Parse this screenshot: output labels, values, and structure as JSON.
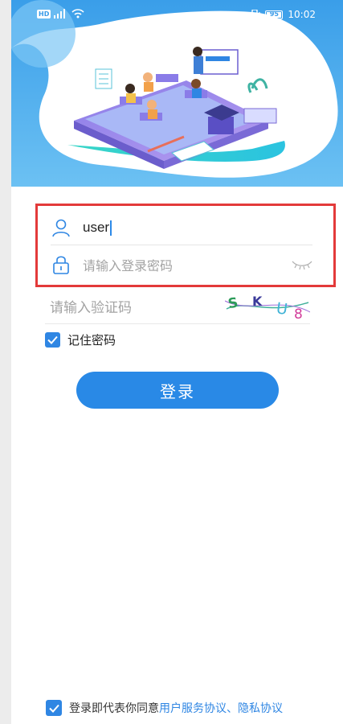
{
  "status_bar": {
    "network": "HD",
    "battery_level": "95",
    "time": "10:02"
  },
  "login": {
    "username_value": "user",
    "password_placeholder": "请输入登录密码",
    "captcha_placeholder": "请输入验证码",
    "captcha_chars": [
      "S",
      "K",
      "U",
      "8"
    ],
    "remember_label": "记住密码",
    "remember_checked": true,
    "login_button": "登录"
  },
  "agreement": {
    "checked": true,
    "prefix": "登录即代表你同意",
    "user_agreement": "用户服务协议",
    "separator": "、",
    "privacy_agreement": "隐私协议"
  },
  "colors": {
    "accent": "#2989e6",
    "highlight_border": "#e33a3a",
    "sky": "#3fa4f0"
  }
}
